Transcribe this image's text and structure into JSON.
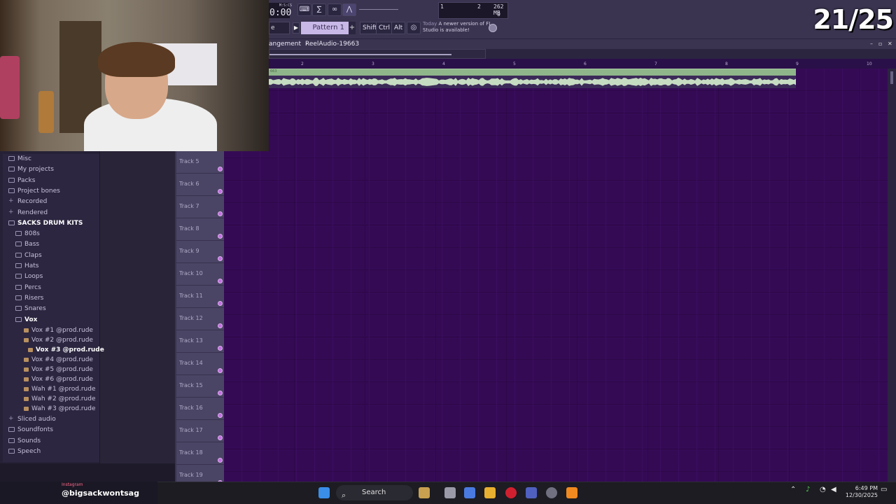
{
  "overlay": {
    "counter": "21/25"
  },
  "toolbar": {
    "time_value": "0:00",
    "time_unit": "M:S:CS",
    "cpu_left": "1",
    "cpu_mid": "2",
    "cpu_mem": "262 MB",
    "cpu_right": "0",
    "arrange_box": "e",
    "pattern": "Pattern 1",
    "pattern_plus": "+",
    "shift": "Shift",
    "ctrl": "Ctrl",
    "alt": "Alt",
    "news_today": "Today",
    "news_text": "A newer version of FL Studio is available!"
  },
  "playlist": {
    "breadcrumb_1": "angement",
    "breadcrumb_2": "ReelAudio-19663",
    "clip_label": "663",
    "ruler": [
      "2",
      "3",
      "4",
      "5",
      "6",
      "7",
      "8",
      "9",
      "10"
    ],
    "tracks": [
      "Track 5",
      "Track 6",
      "Track 7",
      "Track 8",
      "Track 9",
      "Track 10",
      "Track 11",
      "Track 12",
      "Track 13",
      "Track 14",
      "Track 15",
      "Track 16",
      "Track 17",
      "Track 18",
      "Track 19"
    ]
  },
  "browser": {
    "items": [
      {
        "label": "Misc",
        "icon": "folder-icon"
      },
      {
        "label": "My projects",
        "icon": "folder-icon"
      },
      {
        "label": "Packs",
        "icon": "packs-icon"
      },
      {
        "label": "Project bones",
        "icon": "folder-icon"
      },
      {
        "label": "Recorded",
        "icon": "plus-icon"
      },
      {
        "label": "Rendered",
        "icon": "plus-icon"
      },
      {
        "label": "SACKS DRUM KITS",
        "icon": "folder-open-icon"
      },
      {
        "label": "808s",
        "icon": "folder-icon"
      },
      {
        "label": "Bass",
        "icon": "folder-icon"
      },
      {
        "label": "Claps",
        "icon": "folder-icon"
      },
      {
        "label": "Hats",
        "icon": "folder-icon"
      },
      {
        "label": "Loops",
        "icon": "folder-icon"
      },
      {
        "label": "Percs",
        "icon": "folder-icon"
      },
      {
        "label": "Risers",
        "icon": "folder-icon"
      },
      {
        "label": "Snares",
        "icon": "folder-icon"
      },
      {
        "label": "Vox",
        "icon": "folder-open-icon"
      },
      {
        "label": "Vox #1 @prod.rude",
        "icon": "audio-file-icon"
      },
      {
        "label": "Vox #2 @prod.rude",
        "icon": "audio-file-icon"
      },
      {
        "label": "Vox #3 @prod.rude",
        "icon": "audio-file-icon"
      },
      {
        "label": "Vox #4 @prod.rude",
        "icon": "audio-file-icon"
      },
      {
        "label": "Vox #5 @prod.rude",
        "icon": "audio-file-icon"
      },
      {
        "label": "Vox #6 @prod.rude",
        "icon": "audio-file-icon"
      },
      {
        "label": "Wah #1 @prod.rude",
        "icon": "audio-file-icon"
      },
      {
        "label": "Wah #2 @prod.rude",
        "icon": "audio-file-icon"
      },
      {
        "label": "Wah #3 @prod.rude",
        "icon": "audio-file-icon"
      },
      {
        "label": "Sliced audio",
        "icon": "plus-icon"
      },
      {
        "label": "Soundfonts",
        "icon": "folder-icon"
      },
      {
        "label": "Sounds",
        "icon": "cloud-icon"
      },
      {
        "label": "Speech",
        "icon": "folder-icon"
      }
    ]
  },
  "social": {
    "platform": "Instagram",
    "handle": "@bigsackwontsag"
  },
  "taskbar": {
    "search": "Search",
    "time": "6:49 PM",
    "date": "12/30/2025"
  }
}
